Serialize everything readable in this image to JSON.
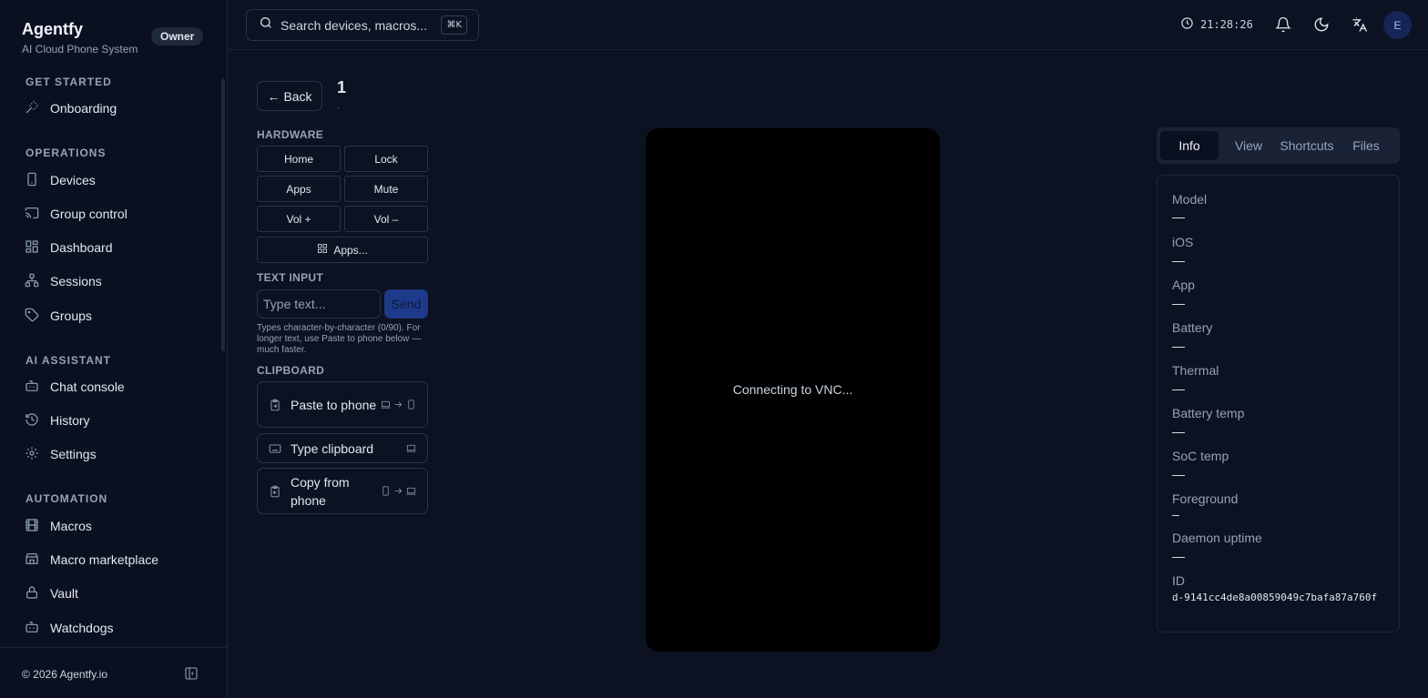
{
  "brand": {
    "name": "Agentfy",
    "subtitle": "AI Cloud Phone System",
    "role": "Owner"
  },
  "sidebar": {
    "sections": [
      {
        "label": "GET STARTED",
        "items": [
          {
            "label": "Onboarding",
            "icon": "wand-icon"
          }
        ]
      },
      {
        "label": "OPERATIONS",
        "items": [
          {
            "label": "Devices",
            "icon": "smartphone-icon"
          },
          {
            "label": "Group control",
            "icon": "cast-icon"
          },
          {
            "label": "Dashboard",
            "icon": "dashboard-icon"
          },
          {
            "label": "Sessions",
            "icon": "network-icon"
          },
          {
            "label": "Groups",
            "icon": "tag-icon"
          }
        ]
      },
      {
        "label": "AI ASSISTANT",
        "items": [
          {
            "label": "Chat console",
            "icon": "bot-icon"
          },
          {
            "label": "History",
            "icon": "history-icon"
          },
          {
            "label": "Settings",
            "icon": "gear-icon"
          }
        ]
      },
      {
        "label": "AUTOMATION",
        "items": [
          {
            "label": "Macros",
            "icon": "film-icon"
          },
          {
            "label": "Macro marketplace",
            "icon": "store-icon"
          },
          {
            "label": "Vault",
            "icon": "lock-icon"
          },
          {
            "label": "Watchdogs",
            "icon": "bot-icon"
          }
        ]
      }
    ],
    "footer": {
      "copyright": "© 2026 Agentfy.io"
    }
  },
  "topbar": {
    "search_placeholder": "Search devices, macros...",
    "shortcut": "⌘K",
    "time": "21:28:26",
    "avatar_initial": "E"
  },
  "device": {
    "back_label": "Back",
    "title": "1",
    "subtitle": ".",
    "hardware_label": "HARDWARE",
    "hardware_buttons": [
      "Home",
      "Lock",
      "Apps",
      "Mute",
      "Vol +",
      "Vol –"
    ],
    "apps_button": "Apps...",
    "text_input_label": "TEXT INPUT",
    "text_input_placeholder": "Type text...",
    "send_label": "Send",
    "hint": "Types character-by-character (0/90). For longer text, use Paste to phone below — much faster.",
    "clipboard_label": "CLIPBOARD",
    "clipboard_buttons": [
      "Paste to phone",
      "Type clipboard",
      "Copy from phone"
    ],
    "vnc_status": "Connecting to VNC..."
  },
  "info_panel": {
    "tabs": [
      "Info",
      "View",
      "Shortcuts",
      "Files"
    ],
    "active_tab": "Info",
    "fields": [
      {
        "key": "Model",
        "value": "—"
      },
      {
        "key": "iOS",
        "value": "—"
      },
      {
        "key": "App",
        "value": "—"
      },
      {
        "key": "Battery",
        "value": "—"
      },
      {
        "key": "Thermal",
        "value": "—"
      },
      {
        "key": "Battery temp",
        "value": "—"
      },
      {
        "key": "SoC temp",
        "value": "—"
      },
      {
        "key": "Foreground",
        "value": "–"
      },
      {
        "key": "Daemon uptime",
        "value": "—"
      }
    ],
    "id_label": "ID",
    "id_value": "d-9141cc4de8a00859049c7bafa87a760f"
  }
}
